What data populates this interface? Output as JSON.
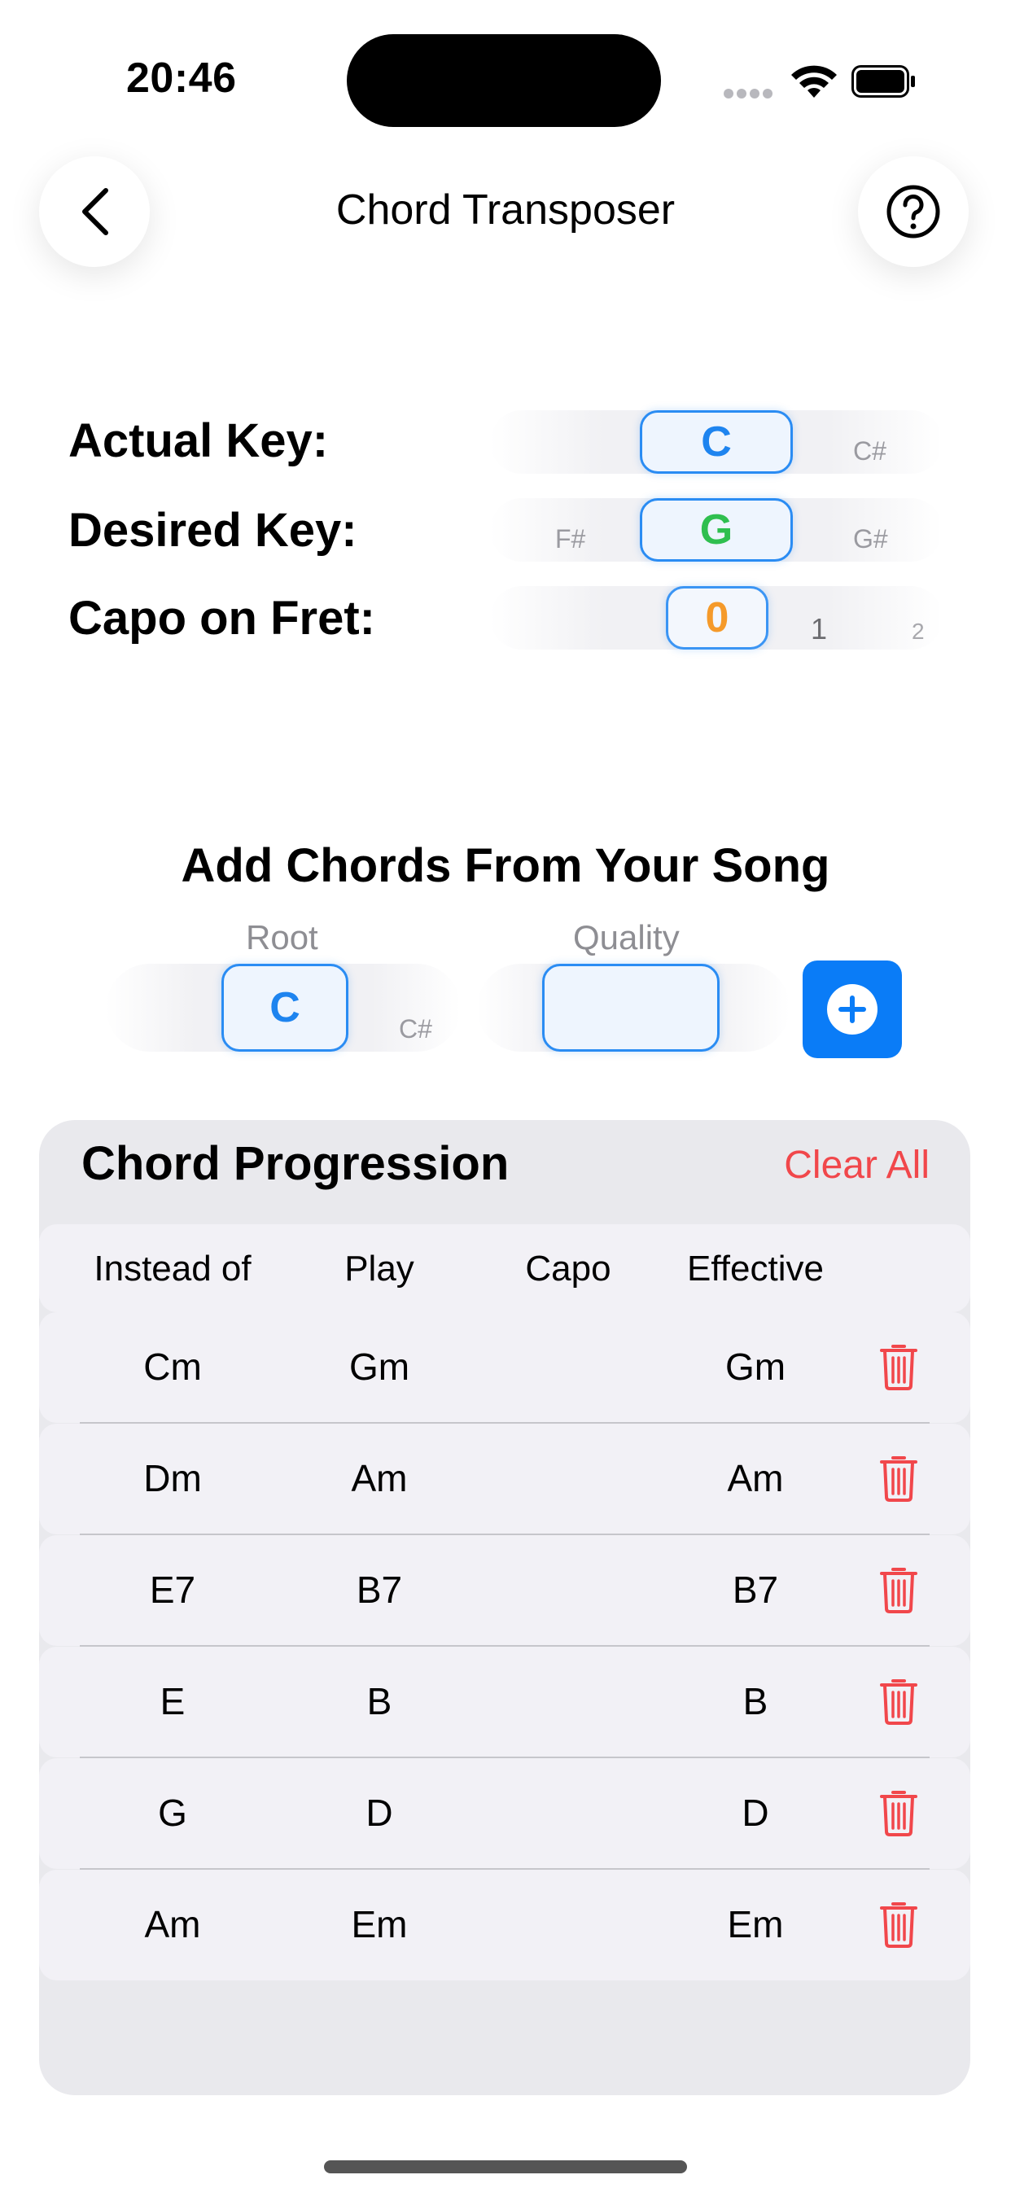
{
  "status_bar": {
    "time": "20:46"
  },
  "nav": {
    "title": "Chord Transposer"
  },
  "keys": {
    "actual": {
      "label": "Actual Key:",
      "selected": "C",
      "next": "C#"
    },
    "desired": {
      "label": "Desired Key:",
      "prev": "F#",
      "selected": "G",
      "next": "G#"
    },
    "capo": {
      "label": "Capo on Fret:",
      "selected": "0",
      "next1": "1",
      "next2": "2"
    }
  },
  "add_chords": {
    "title": "Add Chords From Your Song",
    "root_label": "Root",
    "root_selected": "C",
    "root_next": "C#",
    "quality_label": "Quality",
    "quality_selected": ""
  },
  "progression": {
    "title": "Chord Progression",
    "clear_label": "Clear All",
    "columns": [
      "Instead of",
      "Play",
      "Capo",
      "Effective"
    ],
    "rows": [
      {
        "instead_of": "Cm",
        "play": "Gm",
        "capo": "",
        "effective": "Gm"
      },
      {
        "instead_of": "Dm",
        "play": "Am",
        "capo": "",
        "effective": "Am"
      },
      {
        "instead_of": "E7",
        "play": "B7",
        "capo": "",
        "effective": "B7"
      },
      {
        "instead_of": "E",
        "play": "B",
        "capo": "",
        "effective": "B"
      },
      {
        "instead_of": "G",
        "play": "D",
        "capo": "",
        "effective": "D"
      },
      {
        "instead_of": "Am",
        "play": "Em",
        "capo": "",
        "effective": "Em"
      }
    ]
  },
  "colors": {
    "accent_blue": "#0a7cf7",
    "key_green": "#2fbf4f",
    "capo_orange": "#f59a2a",
    "destructive_red": "#f1474b"
  }
}
